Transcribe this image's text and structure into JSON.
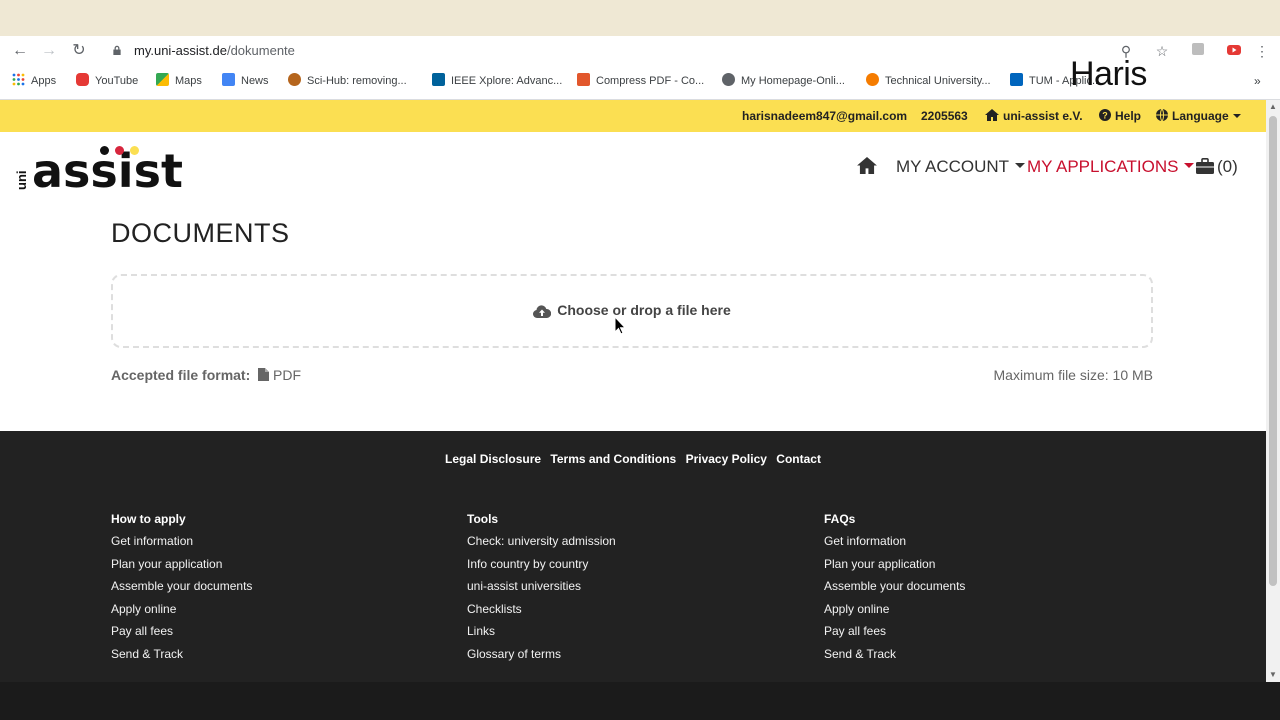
{
  "browser": {
    "url_domain": "my.uni-assist.de",
    "url_path": "/dokumente",
    "bookmarks": [
      {
        "label": "Apps",
        "icon": "apps-grid-icon"
      },
      {
        "label": "YouTube",
        "icon": "youtube-icon"
      },
      {
        "label": "Maps",
        "icon": "maps-icon"
      },
      {
        "label": "News",
        "icon": "news-icon"
      },
      {
        "label": "Sci-Hub: removing...",
        "icon": "scihub-icon"
      },
      {
        "label": "IEEE Xplore: Advanc...",
        "icon": "ieee-icon"
      },
      {
        "label": "Compress PDF - Co...",
        "icon": "pdf-icon"
      },
      {
        "label": "My Homepage-Onli...",
        "icon": "globe-icon"
      },
      {
        "label": "Technical University...",
        "icon": "university-icon"
      },
      {
        "label": "TUM - Applic...",
        "icon": "tum-icon"
      }
    ],
    "overlay_name": "Haris"
  },
  "topbar": {
    "email": "harisnadeem847@gmail.com",
    "applicant_id": "2205563",
    "org": "uni-assist e.V.",
    "help": "Help",
    "language": "Language"
  },
  "logo": {
    "prefix": "uni",
    "word": "assist"
  },
  "nav": {
    "my_account": "MY ACCOUNT",
    "my_applications": "MY APPLICATIONS",
    "cart_count": "(0)"
  },
  "page": {
    "title": "DOCUMENTS",
    "dropzone_label": "Choose or drop a file here",
    "accepted_label": "Accepted file format:",
    "accepted_format": "PDF",
    "max_size": "Maximum file size: 10 MB"
  },
  "footer": {
    "legal": [
      "Legal Disclosure",
      "Terms and Conditions",
      "Privacy Policy",
      "Contact"
    ],
    "columns": [
      {
        "heading": "How to apply",
        "links": [
          "Get information",
          "Plan your application",
          "Assemble your documents",
          "Apply online",
          "Pay all fees",
          "Send & Track"
        ]
      },
      {
        "heading": "Tools",
        "links": [
          "Check: university admission",
          "Info country by country",
          "uni-assist universities",
          "Checklists",
          "Links",
          "Glossary of terms"
        ]
      },
      {
        "heading": "FAQs",
        "links": [
          "Get information",
          "Plan your application",
          "Assemble your documents",
          "Apply online",
          "Pay all fees",
          "Send & Track"
        ]
      }
    ]
  },
  "colors": {
    "topbar_bg": "#fbdf52",
    "accent_red": "#c8102e",
    "footer_bg": "#222222"
  }
}
